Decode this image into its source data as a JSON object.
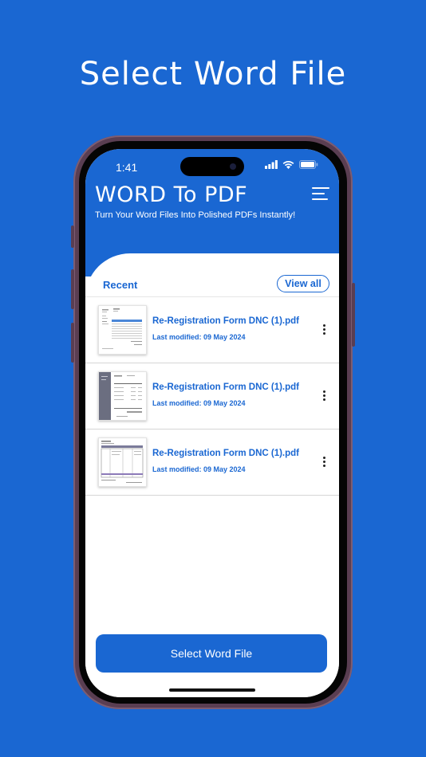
{
  "promo": {
    "headline": "Select Word File"
  },
  "status_bar": {
    "time": "1:41"
  },
  "app": {
    "title": "WORD To PDF",
    "subtitle": "Turn Your Word Files Into Polished PDFs Instantly!",
    "menu_icon": "hamburger-menu-icon"
  },
  "recent": {
    "label": "Recent",
    "view_all": "View all",
    "files": [
      {
        "name": "Re-Registration Form  DNC (1).pdf",
        "modified": "Last modified: 09 May 2024",
        "thumb": "table-document"
      },
      {
        "name": "Re-Registration Form  DNC (1).pdf",
        "modified": "Last modified: 09 May 2024",
        "thumb": "invoice-sidebar-document"
      },
      {
        "name": "Re-Registration Form  DNC (1).pdf",
        "modified": "Last modified: 09 May 2024",
        "thumb": "invoice-grid-document"
      }
    ]
  },
  "select_button": {
    "label": "Select Word File"
  },
  "colors": {
    "brand": "#1a67d2",
    "background": "#ffffff",
    "divider": "#d5d5d5"
  }
}
